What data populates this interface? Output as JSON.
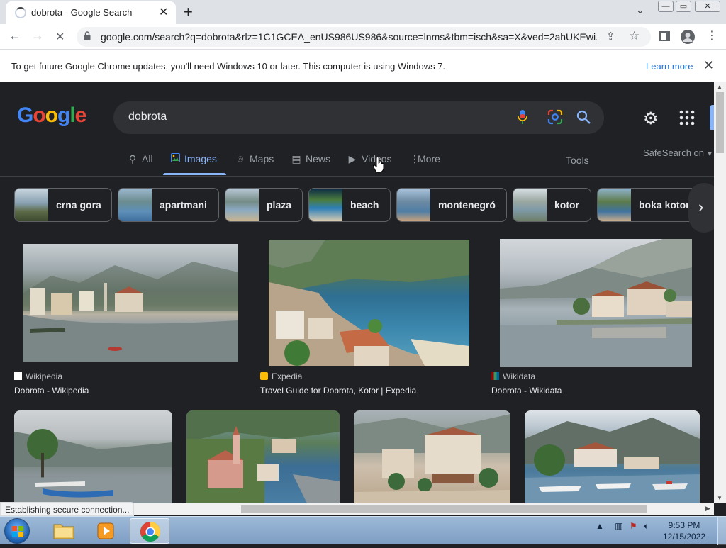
{
  "browser": {
    "tab_title": "dobrota - Google Search",
    "tab_close": "✕",
    "new_tab": "+",
    "tab_search": "⌄",
    "window_controls": {
      "minimize": "—",
      "maximize": "▭",
      "close": "✕"
    },
    "url": "google.com/search?q=dobrota&rlz=1C1GCEA_enUS986US986&source=lnms&tbm=isch&sa=X&ved=2ahUKEwi...",
    "back": "←",
    "forward": "→",
    "reload": "✕",
    "kebab": "⋮"
  },
  "infobar": {
    "message": "To get future Google Chrome updates, you'll need Windows 10 or later. This computer is using Windows 7.",
    "link": "Learn more",
    "close": "✕"
  },
  "google": {
    "logo_letters": [
      "G",
      "o",
      "o",
      "g",
      "l",
      "e"
    ],
    "logo_colors": [
      "#4285f4",
      "#ea4335",
      "#fbbc05",
      "#4285f4",
      "#34a853",
      "#ea4335"
    ],
    "query": "dobrota",
    "nav": {
      "all": "All",
      "images": "Images",
      "maps": "Maps",
      "news": "News",
      "videos": "Videos",
      "more": "More",
      "tools": "Tools",
      "safesearch": "SafeSearch on"
    },
    "chips": [
      "crna gora",
      "apartmani",
      "plaza",
      "beach",
      "montenegró",
      "kotor",
      "boka kotor"
    ],
    "results": [
      {
        "source": "Wikipedia",
        "caption": "Dobrota - Wikipedia"
      },
      {
        "source": "Expedia",
        "caption": "Travel Guide for Dobrota, Kotor | Expedia"
      },
      {
        "source": "Wikidata",
        "caption": "Dobrota - Wikidata"
      }
    ]
  },
  "status": "Establishing secure connection...",
  "taskbar": {
    "time": "9:53 PM",
    "date": "12/15/2022"
  },
  "colors": {
    "accent": "#8ab4f8",
    "page_bg": "#202124",
    "searchbox_bg": "#303134"
  }
}
